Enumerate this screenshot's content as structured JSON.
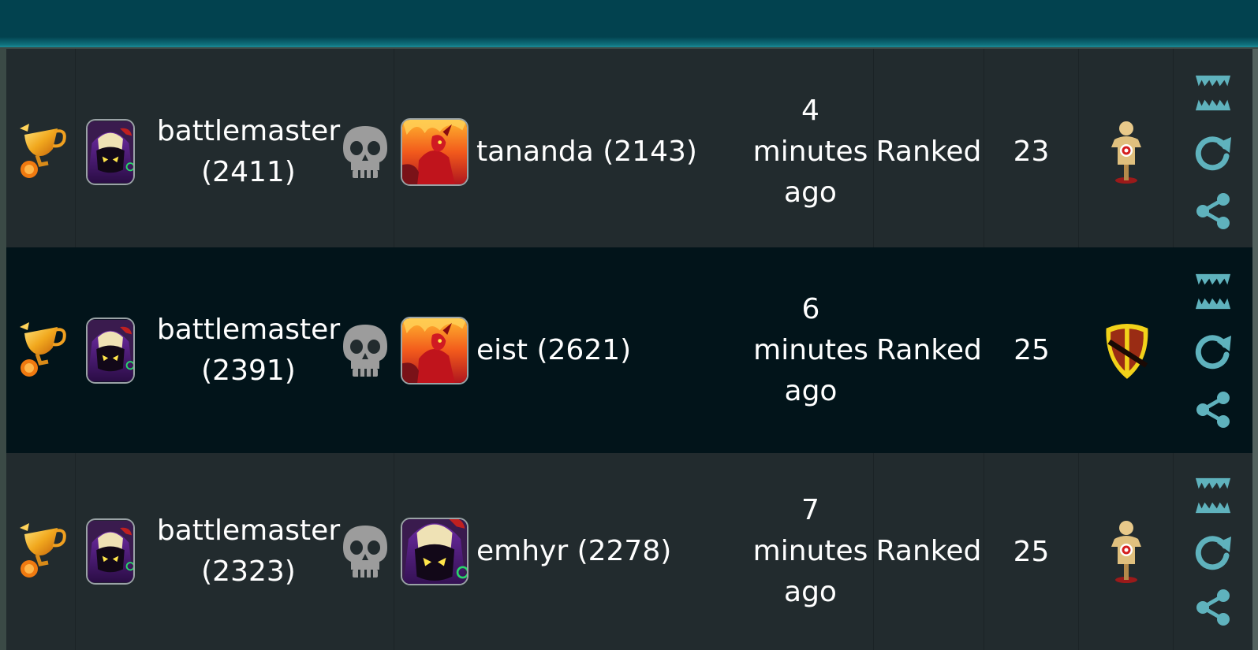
{
  "colors": {
    "topbar": "#02424f",
    "row_light": "#222b2e",
    "row_dark": "#02141a",
    "icon_teal": "#5fb2bd",
    "skull": "#9a9a9a"
  },
  "matches": [
    {
      "result_icon": "trophy-icon",
      "player_avatar": "skull-hood-avatar",
      "player_name": "battlemaster",
      "player_rating": "(2411)",
      "outcome_icon": "skull-icon",
      "opponent_avatar": "fire-demon-avatar",
      "opponent": "tananda (2143)",
      "time_value": "4",
      "time_unit": "minutes",
      "time_suffix": "ago",
      "mode": "Ranked",
      "turns": "23",
      "deck_icon": "target-dummy-icon"
    },
    {
      "result_icon": "trophy-icon",
      "player_avatar": "skull-hood-avatar",
      "player_name": "battlemaster",
      "player_rating": "(2391)",
      "outcome_icon": "skull-icon",
      "opponent_avatar": "fire-demon-avatar",
      "opponent": "eist (2621)",
      "time_value": "6",
      "time_unit": "minutes",
      "time_suffix": "ago",
      "mode": "Ranked",
      "turns": "25",
      "deck_icon": "shield-icon"
    },
    {
      "result_icon": "trophy-icon",
      "player_avatar": "skull-hood-avatar",
      "player_name": "battlemaster",
      "player_rating": "(2323)",
      "outcome_icon": "skull-icon",
      "opponent_avatar": "skull-hood-avatar",
      "opponent": "emhyr (2278)",
      "time_value": "7",
      "time_unit": "minutes",
      "time_suffix": "ago",
      "mode": "Ranked",
      "turns": "25",
      "deck_icon": "target-dummy-icon"
    }
  ],
  "actions": [
    "fangs-icon",
    "replay-icon",
    "share-icon"
  ]
}
